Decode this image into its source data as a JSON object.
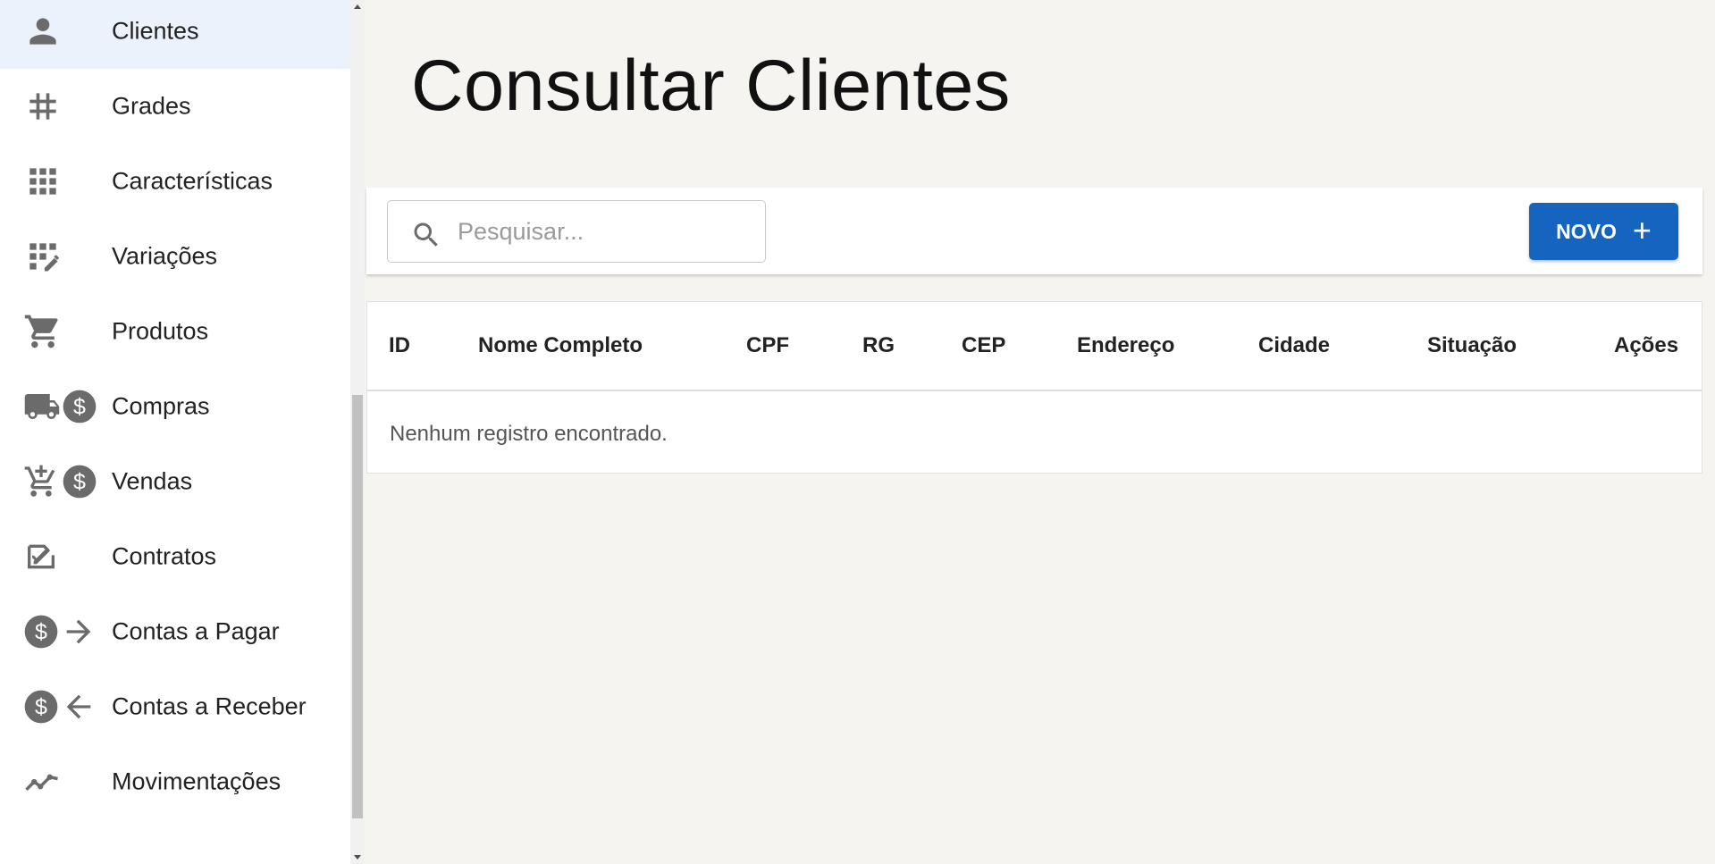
{
  "sidebar": {
    "items": [
      {
        "label": "Clientes",
        "icon": "person-icon",
        "active": true
      },
      {
        "label": "Grades",
        "icon": "hash-icon"
      },
      {
        "label": "Características",
        "icon": "grid-icon"
      },
      {
        "label": "Variações",
        "icon": "grid-edit-icon"
      },
      {
        "label": "Produtos",
        "icon": "cart-icon"
      },
      {
        "label": "Compras",
        "icon": "truck-dollar-icon"
      },
      {
        "label": "Vendas",
        "icon": "cart-add-dollar-icon"
      },
      {
        "label": "Contratos",
        "icon": "contract-icon"
      },
      {
        "label": "Contas a Pagar",
        "icon": "dollar-arrow-right-icon"
      },
      {
        "label": "Contas a Receber",
        "icon": "dollar-arrow-left-icon"
      },
      {
        "label": "Movimentações",
        "icon": "trend-icon"
      }
    ]
  },
  "main": {
    "title": "Consultar Clientes",
    "search": {
      "placeholder": "Pesquisar...",
      "value": ""
    },
    "new_button": {
      "label": "NOVO",
      "icon": "plus-icon"
    },
    "table": {
      "columns": [
        "ID",
        "Nome Completo",
        "CPF",
        "RG",
        "CEP",
        "Endereço",
        "Cidade",
        "Situação",
        "Ações"
      ],
      "empty_message": "Nenhum registro encontrado."
    }
  },
  "colors": {
    "accent": "#1565c0",
    "active_item_bg": "#ebf2fc",
    "page_bg": "#f5f4f1",
    "icon": "#6b6b6b"
  }
}
